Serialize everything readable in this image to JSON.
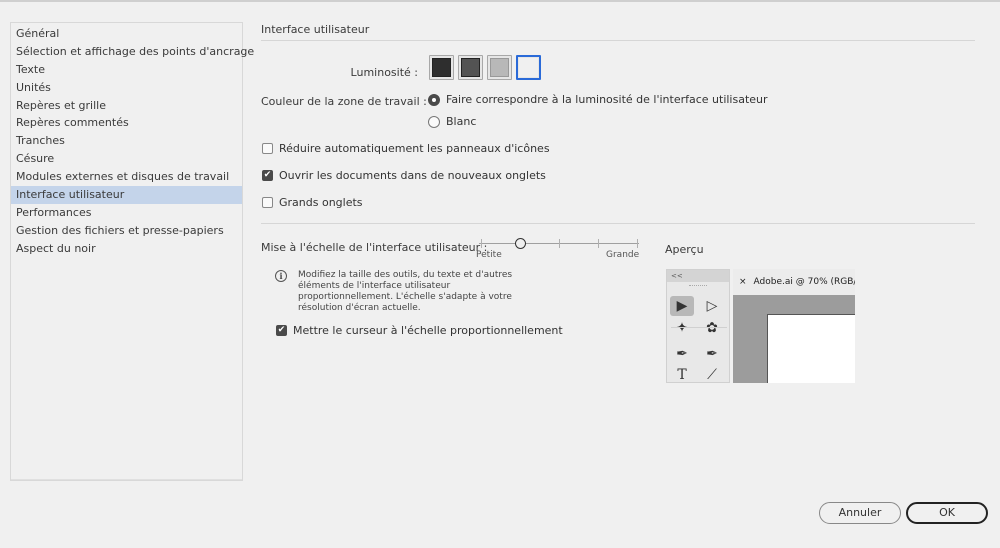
{
  "sidebar": {
    "items": [
      {
        "label": "Général",
        "selected": false
      },
      {
        "label": "Sélection et affichage des points d'ancrage",
        "selected": false
      },
      {
        "label": "Texte",
        "selected": false
      },
      {
        "label": "Unités",
        "selected": false
      },
      {
        "label": "Repères et grille",
        "selected": false
      },
      {
        "label": "Repères commentés",
        "selected": false
      },
      {
        "label": "Tranches",
        "selected": false
      },
      {
        "label": "Césure",
        "selected": false
      },
      {
        "label": "Modules externes et disques de travail",
        "selected": false
      },
      {
        "label": "Interface utilisateur",
        "selected": true
      },
      {
        "label": "Performances",
        "selected": false
      },
      {
        "label": "Gestion des fichiers et presse-papiers",
        "selected": false
      },
      {
        "label": "Aspect du noir",
        "selected": false
      }
    ]
  },
  "main": {
    "section_title": "Interface utilisateur",
    "brightness": {
      "label": "Luminosité :",
      "swatches": [
        {
          "name": "darkest",
          "color": "#2e2e2e",
          "selected": false
        },
        {
          "name": "medium-dark",
          "color": "#535353",
          "selected": false
        },
        {
          "name": "medium-light",
          "color": "#b8b8b8",
          "selected": false
        },
        {
          "name": "lightest",
          "color": "#f0f0f0",
          "selected": true
        }
      ]
    },
    "canvas_color": {
      "label": "Couleur de la zone de travail :",
      "options": [
        {
          "label": "Faire correspondre à la luminosité de l'interface utilisateur",
          "checked": true
        },
        {
          "label": "Blanc",
          "checked": false
        }
      ]
    },
    "checkboxes": [
      {
        "label": "Réduire automatiquement les panneaux d'icônes",
        "checked": false
      },
      {
        "label": "Ouvrir les documents dans de nouveaux onglets",
        "checked": true
      },
      {
        "label": "Grands onglets",
        "checked": false
      }
    ],
    "scaling": {
      "label": "Mise à l'échelle de l'interface utilisateur :",
      "min_label": "Petite",
      "max_label": "Grande",
      "steps": 5,
      "value_index": 1,
      "info_text": "Modifiez la taille des outils, du texte et d'autres éléments de l'interface utilisateur proportionnellement. L'échelle s'adapte à votre résolution d'écran actuelle.",
      "scale_cursor": {
        "label": "Mettre le curseur à l'échelle proportionnellement",
        "checked": true
      }
    },
    "preview": {
      "label": "Aperçu",
      "panel_collapse": "<<",
      "doc_tab_close": "×",
      "doc_tab_title": "Adobe.ai @ 70% (RGB/"
    }
  },
  "footer": {
    "cancel_label": "Annuler",
    "ok_label": "OK"
  }
}
